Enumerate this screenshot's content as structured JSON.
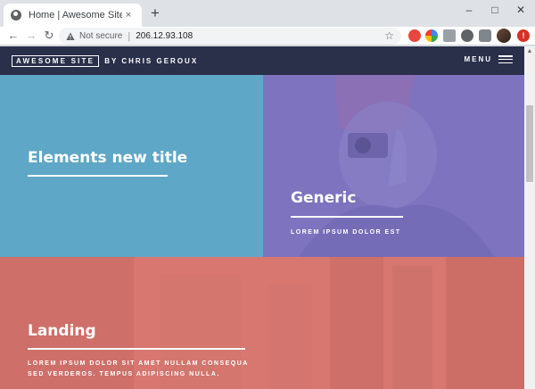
{
  "browser": {
    "tab_title": "Home | Awesome Site",
    "tab_close": "×",
    "new_tab": "+",
    "window_controls": [
      "–",
      "□",
      "✕"
    ],
    "nav": {
      "back": "←",
      "forward": "→",
      "reload": "↻"
    },
    "security_label": "Not secure",
    "separator": "|",
    "url": "206.12.93.108",
    "bookmark_icon": "star-icon",
    "menu_badge": "!"
  },
  "site": {
    "logo": "AWESOME SITE",
    "byline": "BY CHRIS GEROUX",
    "menu_label": "MENU"
  },
  "tiles": [
    {
      "title": "Elements new title",
      "subtitle": "",
      "color": "#5fa7c7"
    },
    {
      "title": "Generic",
      "subtitle": "LOREM IPSUM DOLOR EST",
      "color": "#7d73bf"
    },
    {
      "title": "Landing",
      "subtitle_line1": "LOREM IPSUM DOLOR SIT AMET NULLAM CONSEQUA",
      "subtitle_line2": "SED VERDEROS. TEMPUS ADIPISCING NULLA.",
      "color": "#d7776f"
    }
  ]
}
